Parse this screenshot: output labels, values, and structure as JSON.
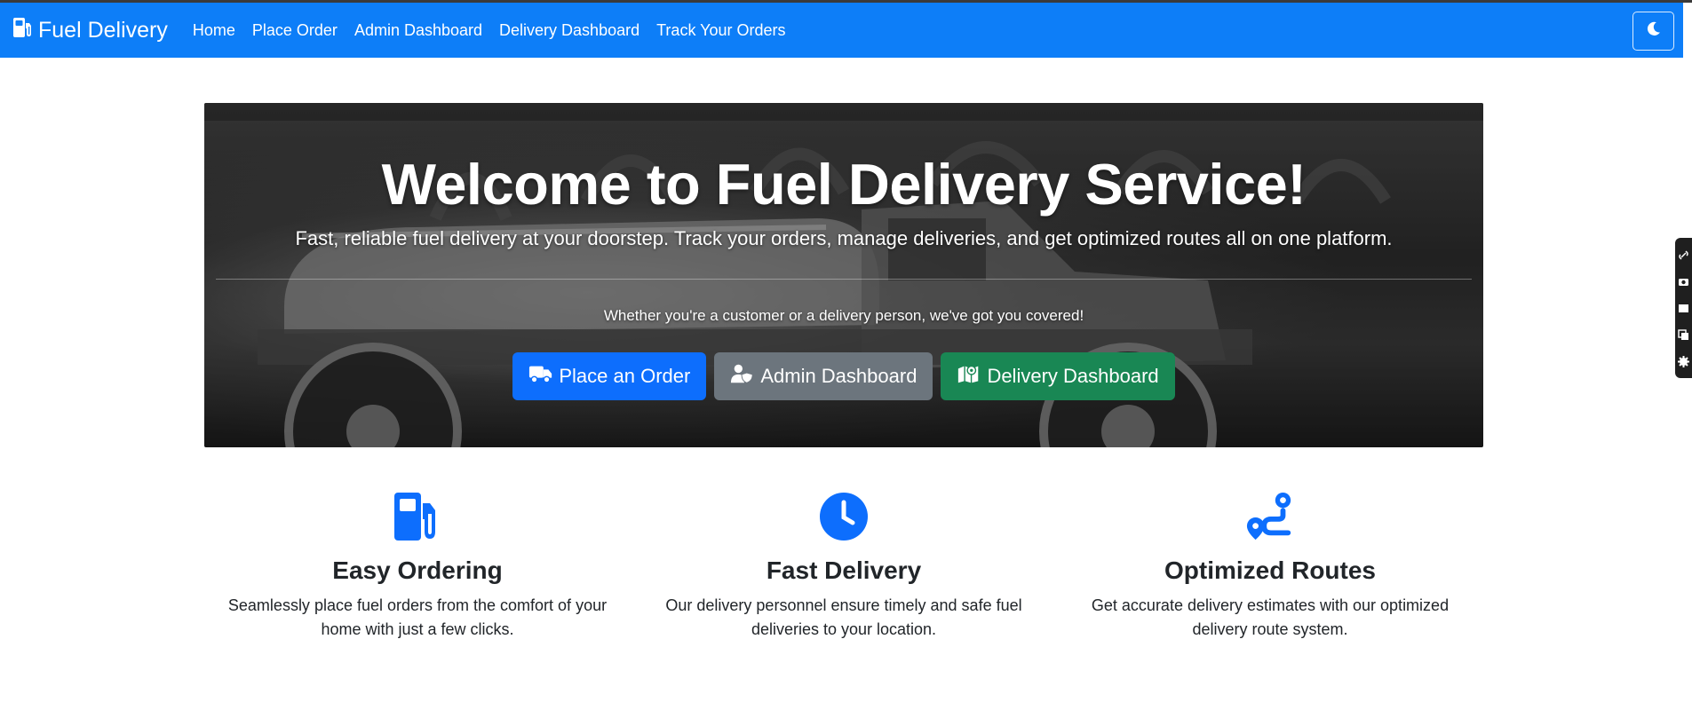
{
  "navbar": {
    "brand": "Fuel Delivery",
    "links": [
      {
        "label": "Home"
      },
      {
        "label": "Place Order"
      },
      {
        "label": "Admin Dashboard"
      },
      {
        "label": "Delivery Dashboard"
      },
      {
        "label": "Track Your Orders"
      }
    ],
    "theme_toggle_icon": "moon-icon",
    "color": "#0d7ef8"
  },
  "hero": {
    "title": "Welcome to Fuel Delivery Service!",
    "lead": "Fast, reliable fuel delivery at your doorstep. Track your orders, manage deliveries, and get optimized routes all on one platform.",
    "sub": "Whether you're a customer or a delivery person, we've got you covered!",
    "background_image": "vintage-fuel-truck-photo",
    "buttons": [
      {
        "label": "Place an Order",
        "icon": "truck-icon",
        "color": "#0d6efd"
      },
      {
        "label": "Admin Dashboard",
        "icon": "user-shield-icon",
        "color": "#6c757d"
      },
      {
        "label": "Delivery Dashboard",
        "icon": "map-location-icon",
        "color": "#198754"
      }
    ]
  },
  "features": [
    {
      "icon": "gas-pump-icon",
      "title": "Easy Ordering",
      "text": "Seamlessly place fuel orders from the comfort of your home with just a few clicks."
    },
    {
      "icon": "clock-icon",
      "title": "Fast Delivery",
      "text": "Our delivery personnel ensure timely and safe fuel deliveries to your location."
    },
    {
      "icon": "route-icon",
      "title": "Optimized Routes",
      "text": "Get accurate delivery estimates with our optimized delivery route system."
    }
  ],
  "accent_color": "#0d6efd",
  "side_toolbar": {
    "tools": [
      "link-icon",
      "camera-icon",
      "square-icon",
      "copy-icon",
      "gear-icon"
    ]
  }
}
